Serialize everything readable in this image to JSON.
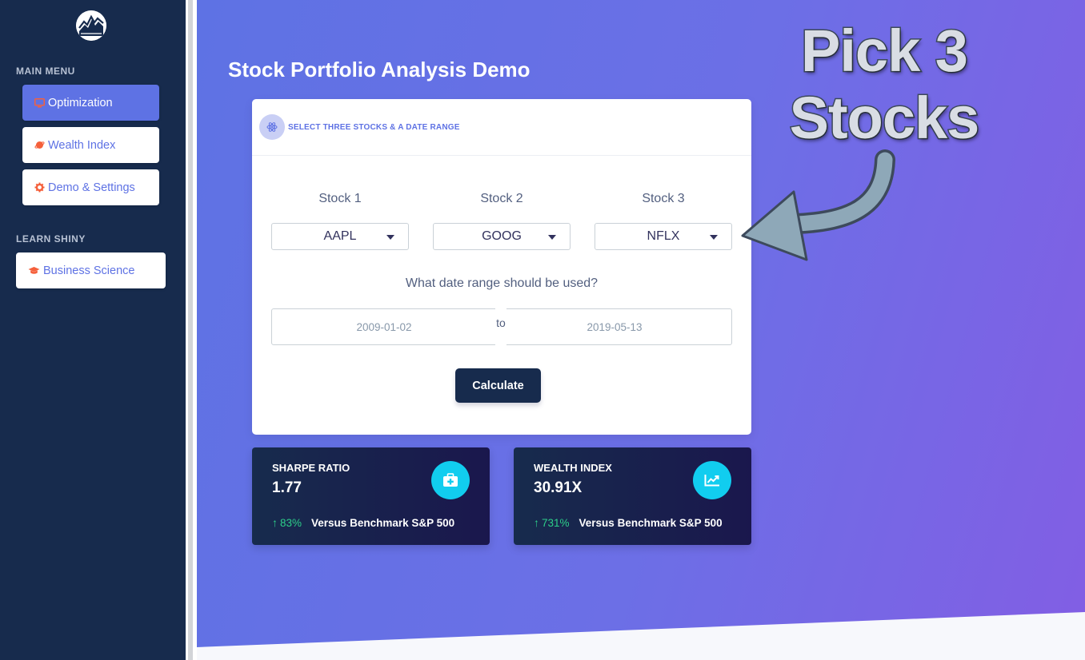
{
  "sidebar": {
    "logo_icon": "stock-chart-logo-icon",
    "main_menu_label": "MAIN MENU",
    "learn_label": "LEARN SHINY",
    "items": [
      {
        "label": "Optimization",
        "icon": "desktop-icon",
        "active": true
      },
      {
        "label": "Wealth Index",
        "icon": "planet-icon",
        "active": false
      },
      {
        "label": "Demo & Settings",
        "icon": "gear-icon",
        "active": false
      }
    ],
    "learn_items": [
      {
        "label": "Business Science",
        "icon": "graduation-cap-icon"
      }
    ]
  },
  "page": {
    "title": "Stock Portfolio Analysis Demo"
  },
  "selector_card": {
    "header": "SELECT THREE STOCKS & A DATE RANGE",
    "header_icon": "atom-icon",
    "stocks": [
      {
        "label": "Stock 1",
        "value": "AAPL"
      },
      {
        "label": "Stock 2",
        "value": "GOOG"
      },
      {
        "label": "Stock 3",
        "value": "NFLX"
      }
    ],
    "date_question": "What date range should be used?",
    "date_start": "2009-01-02",
    "date_separator": "to",
    "date_end": "2019-05-13",
    "calculate_label": "Calculate"
  },
  "stats": [
    {
      "title": "SHARPE RATIO",
      "value": "1.77",
      "icon": "medkit-icon",
      "change": "83%",
      "benchmark": "Versus Benchmark S&P 500"
    },
    {
      "title": "WEALTH INDEX",
      "value": "30.91X",
      "icon": "chart-line-icon",
      "change": "731%",
      "benchmark": "Versus Benchmark S&P 500"
    }
  ],
  "annotation": {
    "line1": "Pick 3",
    "line2": "Stocks"
  },
  "colors": {
    "sidebar": "#172b4d",
    "primary": "#5e72e4",
    "accent_orange": "#f5603b",
    "info": "#11cdef",
    "success": "#2dce89"
  }
}
